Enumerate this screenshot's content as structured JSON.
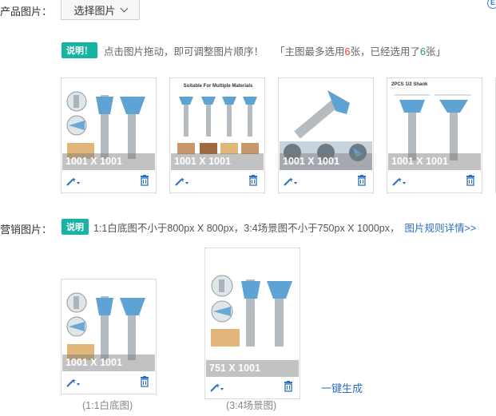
{
  "product_images": {
    "label": "产品图片：",
    "select_button": "选择图片",
    "notice_badge": "说明！",
    "notice_text": "点击图片拖动，即可调整图片顺序！",
    "quota_prefix": "「主图最多选用",
    "quota_max": "6",
    "quota_mid": "张，已经选用了",
    "quota_used": "6",
    "quota_suffix": "张」",
    "cards": [
      {
        "dimension": "1001 X 1001"
      },
      {
        "dimension": "1001 X 1001",
        "banner": "Suitable For Multiple Materials"
      },
      {
        "dimension": "1001 X 1001"
      },
      {
        "dimension": "1001 X 1001",
        "banner": "2PCS 1/2 Shank"
      }
    ]
  },
  "marketing_images": {
    "label": "营销图片：",
    "notice_badge": "说明",
    "notice_text": "1:1白底图不小于800px X 800px，3:4场景图不小于750px X 1000px，",
    "rules_link": "图片规则详情>>",
    "cards": [
      {
        "dimension": "1001 X 1001",
        "caption": "(1:1白底图)"
      },
      {
        "dimension": "751 X 1001",
        "caption": "(3:4场景图)"
      }
    ],
    "one_click": "一键生成"
  },
  "icons": {
    "wand": "magic-wand-icon",
    "trash": "trash-icon",
    "chevron": "chevron-down-icon"
  }
}
